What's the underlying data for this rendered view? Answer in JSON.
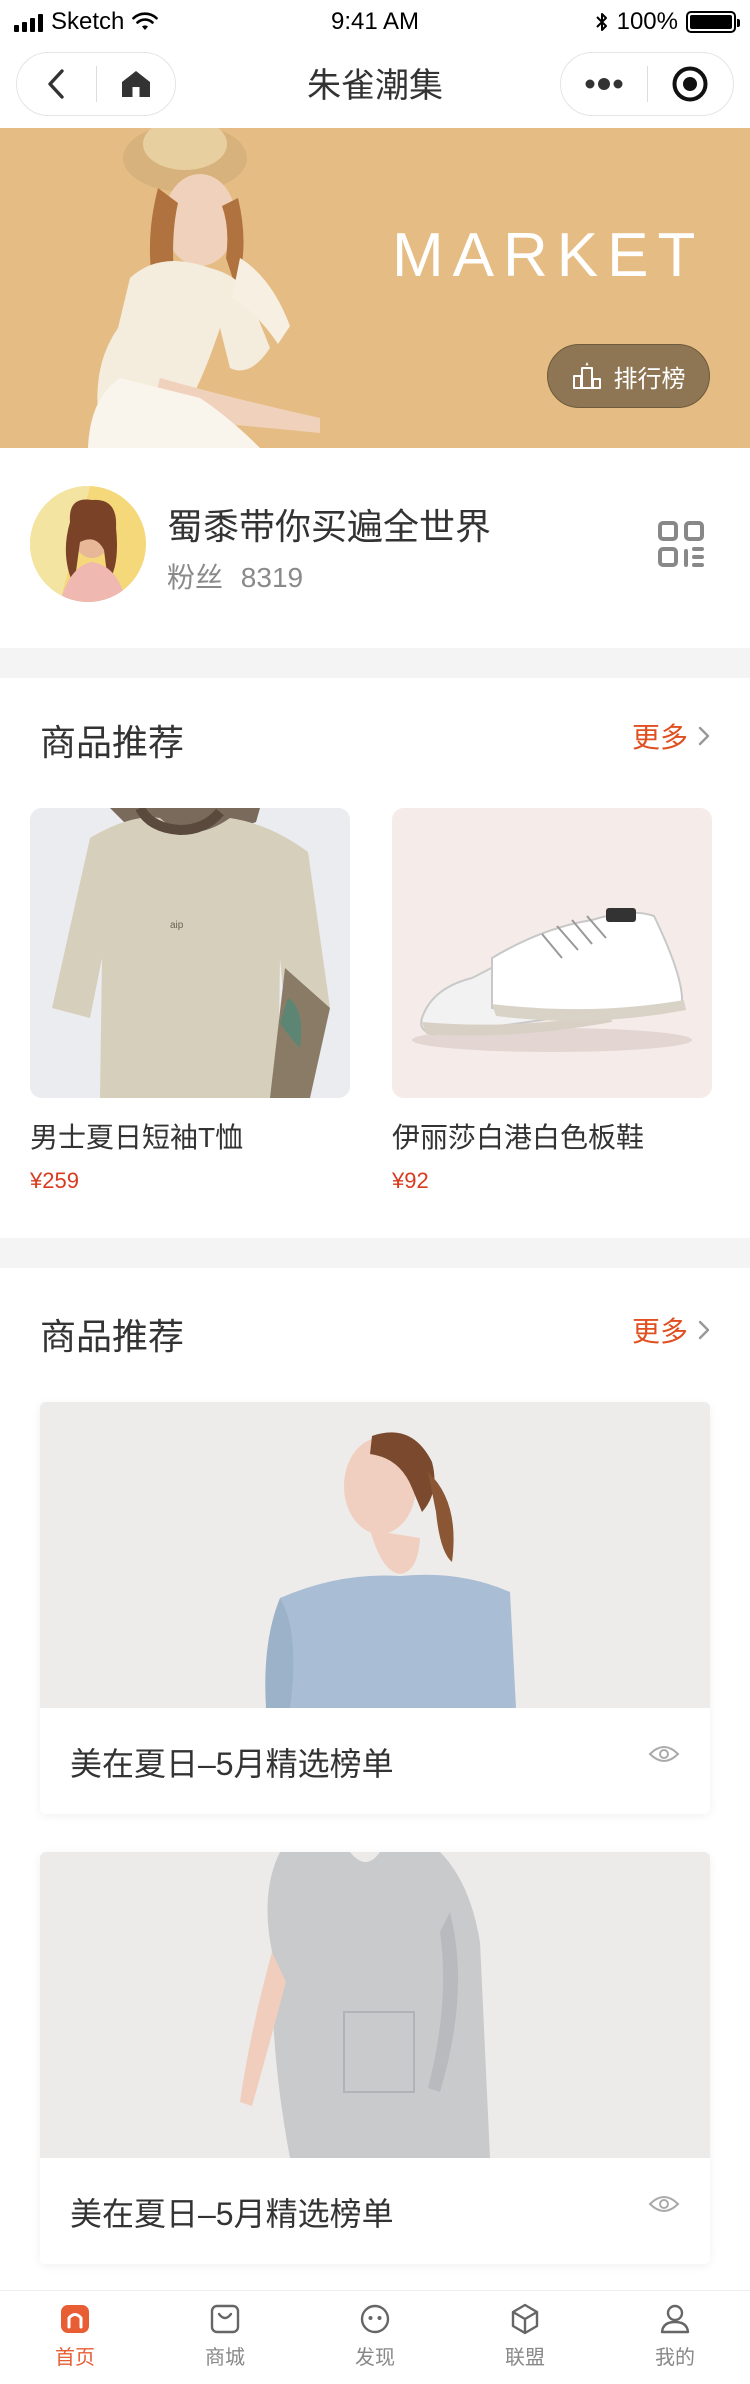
{
  "status_bar": {
    "carrier": "Sketch",
    "time": "9:41 AM",
    "battery": "100%"
  },
  "nav": {
    "title": "朱雀潮集"
  },
  "banner": {
    "title": "MARKET",
    "rank_button_label": "排行榜"
  },
  "profile": {
    "name": "蜀黍带你买遍全世界",
    "fans_label": "粉丝",
    "fans_count": "8319"
  },
  "section1": {
    "title": "商品推荐",
    "more_label": "更多",
    "products": [
      {
        "name": "男士夏日短袖T恤",
        "price": "¥259"
      },
      {
        "name": "伊丽莎白港白色板鞋",
        "price": "¥92"
      }
    ]
  },
  "section2": {
    "title": "商品推荐",
    "more_label": "更多",
    "collections": [
      {
        "title": "美在夏日–5月精选榜单"
      },
      {
        "title": "美在夏日–5月精选榜单"
      }
    ]
  },
  "tab_bar": {
    "items": [
      {
        "label": "首页",
        "icon": "home-icon",
        "active": true
      },
      {
        "label": "商城",
        "icon": "shopping-bag-icon",
        "active": false
      },
      {
        "label": "发现",
        "icon": "discover-icon",
        "active": false
      },
      {
        "label": "联盟",
        "icon": "cube-icon",
        "active": false
      },
      {
        "label": "我的",
        "icon": "user-icon",
        "active": false
      }
    ]
  },
  "colors": {
    "banner_bg": "#e5bd84",
    "accent": "#e04f1f",
    "price": "#d83b1e"
  }
}
